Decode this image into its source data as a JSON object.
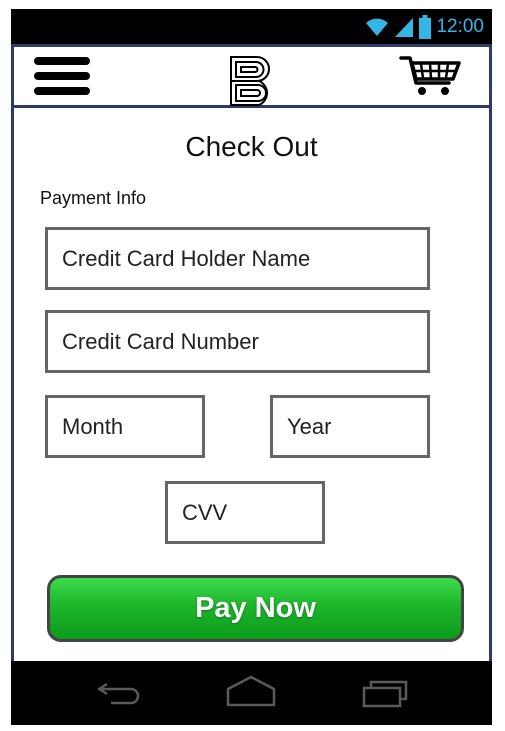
{
  "status_bar": {
    "time": "12:00",
    "icons": [
      "wifi-icon",
      "signal-icon",
      "battery-icon"
    ]
  },
  "app_bar": {
    "icons": [
      "menu-icon",
      "brand-logo-icon",
      "shopping-cart-icon"
    ]
  },
  "checkout": {
    "title": "Check Out",
    "section_label": "Payment Info",
    "fields": {
      "holder_name": {
        "placeholder": "Credit Card Holder Name"
      },
      "card_number": {
        "placeholder": "Credit Card Number"
      },
      "month": {
        "placeholder": "Month"
      },
      "year": {
        "placeholder": "Year"
      },
      "cvv": {
        "placeholder": "CVV"
      }
    },
    "pay_button": "Pay Now"
  },
  "nav_bar": {
    "icons": [
      "back-icon",
      "home-icon",
      "recent-apps-icon"
    ]
  },
  "colors": {
    "accent": "#33b5e5",
    "button_green": "#1db52b",
    "frame_border": "#2d3a6a"
  }
}
